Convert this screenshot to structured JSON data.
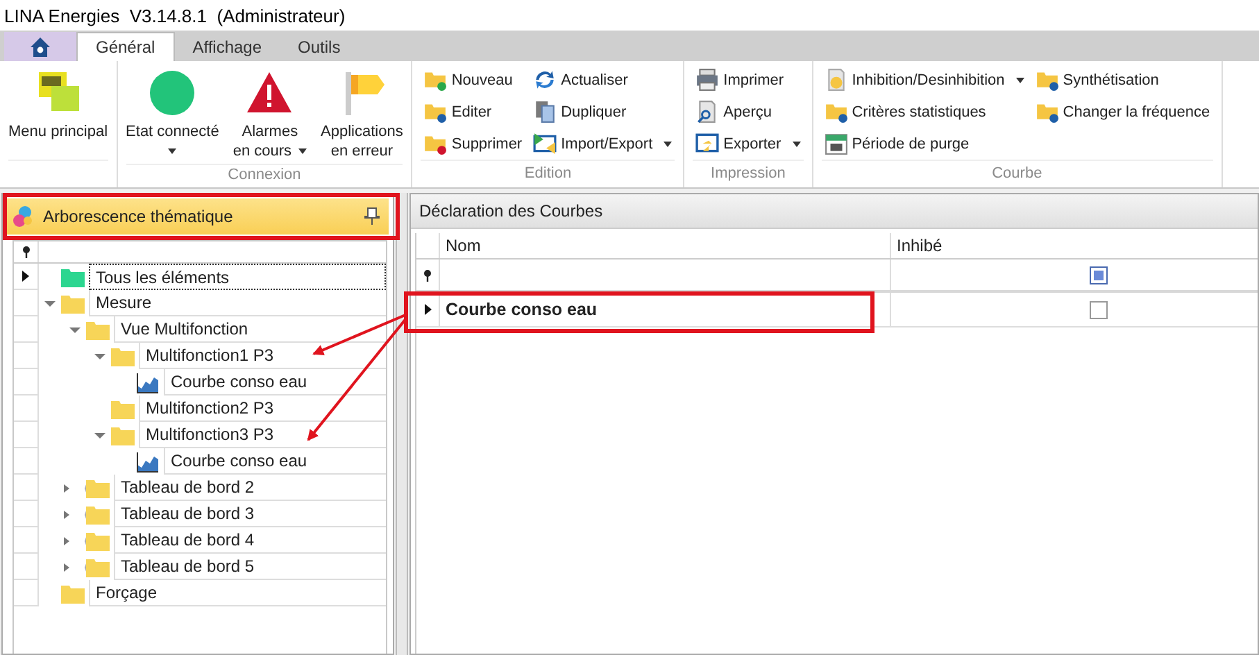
{
  "window": {
    "title": "LINA Energies  V3.14.8.1  (Administrateur)"
  },
  "ribbon_tabs": [
    {
      "kind": "home",
      "selected": false
    },
    {
      "kind": "text",
      "label": "Général",
      "selected": true
    },
    {
      "kind": "text",
      "label": "Affichage",
      "selected": false
    },
    {
      "kind": "text",
      "label": "Outils",
      "selected": false
    }
  ],
  "ribbon_groups": [
    {
      "kind": "large",
      "buttons": [
        {
          "lines": [
            "Menu principal"
          ],
          "dropdown": false
        }
      ]
    },
    {
      "kind": "large",
      "label": "Connexion",
      "buttons": [
        {
          "lines": [
            "Etat connecté"
          ],
          "dropdown": true
        },
        {
          "lines": [
            "Alarmes",
            "en cours"
          ],
          "dropdown": true
        },
        {
          "lines": [
            "Applications",
            "en erreur"
          ],
          "dropdown": false
        }
      ]
    },
    {
      "kind": "small",
      "label": "Edition",
      "buttons": [
        {
          "label": "Nouveau",
          "dropdown": false
        },
        {
          "label": "Editer",
          "dropdown": false
        },
        {
          "label": "Supprimer",
          "dropdown": false
        },
        {
          "label": "Actualiser",
          "dropdown": false
        },
        {
          "label": "Dupliquer",
          "dropdown": false
        },
        {
          "label": "Import/Export",
          "dropdown": true
        }
      ]
    },
    {
      "kind": "small",
      "label": "Impression",
      "buttons": [
        {
          "label": "Imprimer",
          "dropdown": false
        },
        {
          "label": "Aperçu",
          "dropdown": false
        },
        {
          "label": "Exporter",
          "dropdown": true
        }
      ]
    },
    {
      "kind": "small",
      "label": "Courbe",
      "buttons": [
        {
          "label": "Inhibition/Desinhibition",
          "dropdown": true
        },
        {
          "label": "Critères statistiques",
          "dropdown": false
        },
        {
          "label": "Période de purge",
          "dropdown": false
        },
        {
          "label": "Synthétisation",
          "dropdown": false
        },
        {
          "label": "Changer la fréquence",
          "dropdown": false
        }
      ]
    }
  ],
  "left_panel": {
    "title": "Arborescence thématique",
    "tree": [
      {
        "label": "Tous les éléments",
        "kind": "all",
        "selected": true
      },
      {
        "label": "Mesure",
        "kind": "folder",
        "selected": false,
        "expanded": true,
        "children": [
          {
            "label": "Vue Multifonction",
            "kind": "folder",
            "selected": false,
            "expanded": true,
            "children": [
              {
                "label": "Multifonction1 P3",
                "kind": "folder",
                "selected": false,
                "expanded": true,
                "children": [
                  {
                    "label": "Courbe conso eau",
                    "kind": "curve",
                    "selected": false
                  }
                ]
              },
              {
                "label": "Multifonction2 P3",
                "kind": "folder",
                "selected": false
              },
              {
                "label": "Multifonction3 P3",
                "kind": "folder",
                "selected": false,
                "expanded": true,
                "children": [
                  {
                    "label": "Courbe conso eau",
                    "kind": "curve",
                    "selected": false
                  }
                ]
              }
            ]
          },
          {
            "label": "Tableau de bord 2",
            "kind": "folder",
            "selected": false,
            "expanded": false
          },
          {
            "label": "Tableau de bord 3",
            "kind": "folder",
            "selected": false,
            "expanded": false
          },
          {
            "label": "Tableau de bord 4",
            "kind": "folder",
            "selected": false,
            "expanded": false
          },
          {
            "label": "Tableau de bord 5",
            "kind": "folder",
            "selected": false,
            "expanded": false
          }
        ]
      },
      {
        "label": "Forçage",
        "kind": "folder",
        "selected": false
      }
    ]
  },
  "right_panel": {
    "title": "Déclaration des Courbes",
    "columns": [
      "Nom",
      "Inhibé"
    ],
    "filter": {
      "inhibited_indeterminate": true
    },
    "rows": [
      {
        "name": "Courbe conso eau",
        "inhibited": false,
        "selected": true
      }
    ]
  }
}
